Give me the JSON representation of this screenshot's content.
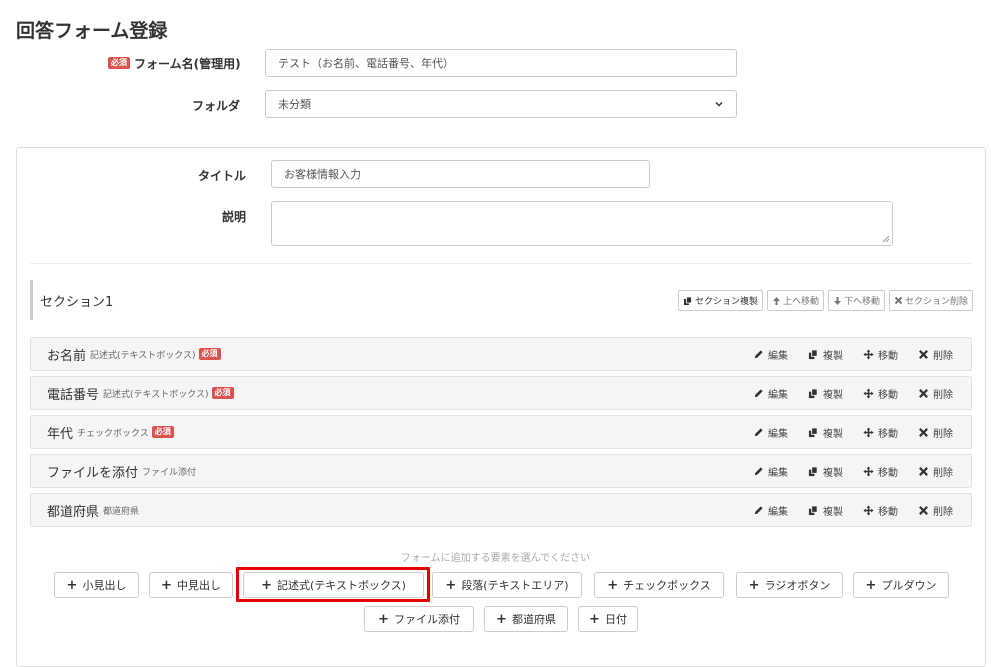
{
  "page": {
    "title": "回答フォーム登録"
  },
  "form_name": {
    "label": "フォーム名(管理用)",
    "required_badge": "必須",
    "value": "テスト（お名前、電話番号、年代）"
  },
  "folder": {
    "label": "フォルダ",
    "selected": "未分類"
  },
  "title_field": {
    "label": "タイトル",
    "value": "お客様情報入力"
  },
  "description_field": {
    "label": "説明",
    "value": ""
  },
  "section": {
    "name": "セクション1",
    "buttons": {
      "copy": "セクション複製",
      "up": "上へ移動",
      "down": "下へ移動",
      "delete": "セクション削除"
    }
  },
  "questions": [
    {
      "title": "お名前",
      "type": "記述式(テキストボックス)",
      "required": "必須"
    },
    {
      "title": "電話番号",
      "type": "記述式(テキストボックス)",
      "required": "必須"
    },
    {
      "title": "年代",
      "type": "チェックボックス",
      "required": "必須"
    },
    {
      "title": "ファイルを添付",
      "type": "ファイル添付",
      "required": ""
    },
    {
      "title": "都道府県",
      "type": "都道府県",
      "required": ""
    }
  ],
  "question_actions": {
    "edit": "編集",
    "copy": "複製",
    "move": "移動",
    "delete": "削除"
  },
  "add_section": {
    "hint": "フォームに追加する要素を選んでください",
    "buttons": {
      "small_heading": "小見出し",
      "medium_heading": "中見出し",
      "textbox": "記述式(テキストボックス)",
      "textarea": "段落(テキストエリア)",
      "checkbox": "チェックボックス",
      "radio": "ラジオボタン",
      "pulldown": "プルダウン",
      "file": "ファイル添付",
      "prefecture": "都道府県",
      "date": "日付"
    }
  },
  "colors": {
    "required": "#d9534f",
    "highlight": "#e60000"
  }
}
